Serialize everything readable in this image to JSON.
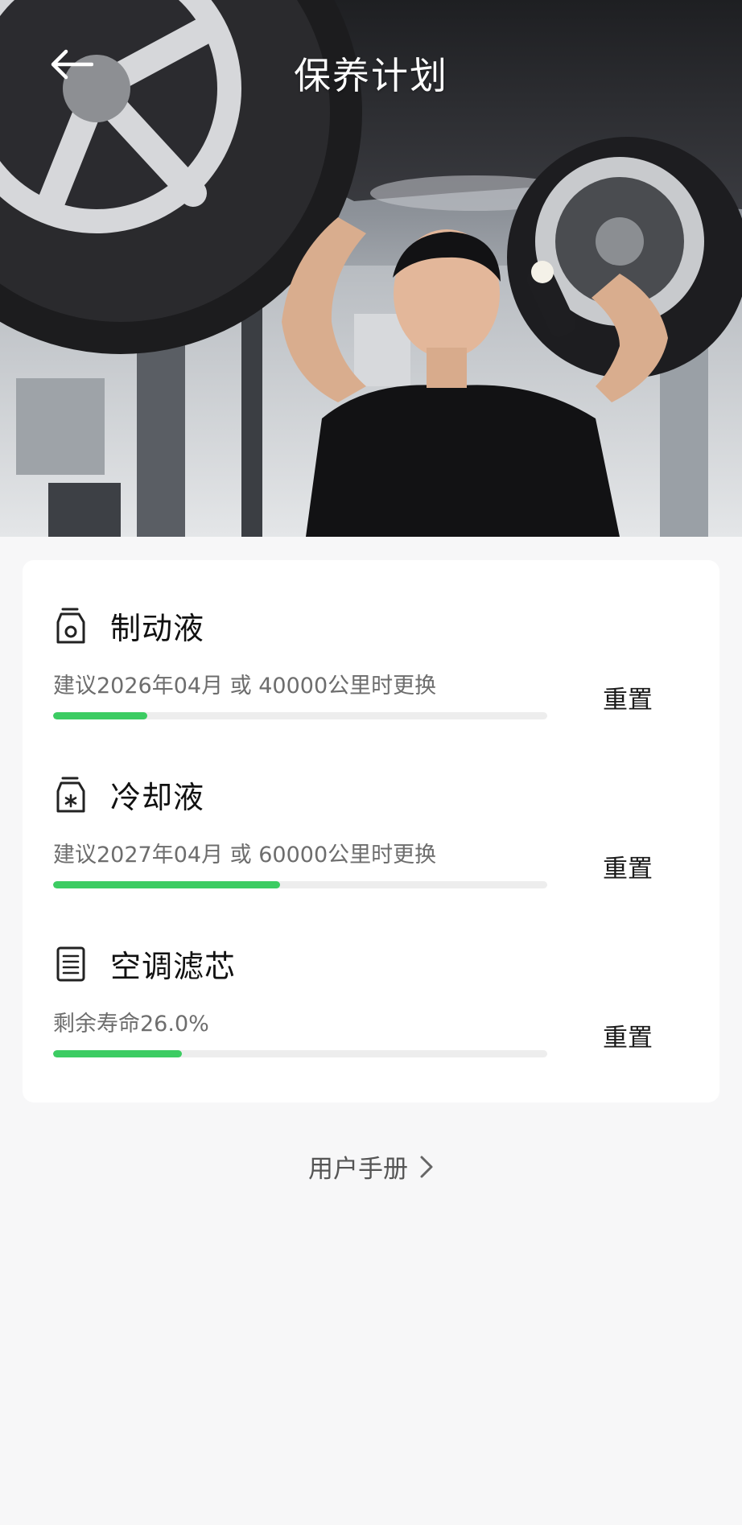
{
  "header": {
    "title": "保养计划",
    "back_icon": "arrow-left-icon"
  },
  "hero": {
    "description_icon": "photo"
  },
  "maintenance": {
    "items": [
      {
        "icon": "brake-fluid-bottle-icon",
        "title": "制动液",
        "desc": "建议2026年04月 或 40000公里时更换",
        "progress": 0.19,
        "reset_label": "重置"
      },
      {
        "icon": "coolant-bottle-icon",
        "title": "冷却液",
        "desc": "建议2027年04月 或 60000公里时更换",
        "progress": 0.46,
        "reset_label": "重置"
      },
      {
        "icon": "filter-document-icon",
        "title": "空调滤芯",
        "desc": "剩余寿命26.0%",
        "progress": 0.26,
        "reset_label": "重置"
      }
    ]
  },
  "footer": {
    "manual_label": "用户手册"
  },
  "colors": {
    "progress_fill": "#3ccc62",
    "progress_track": "#ededed",
    "page_bg": "#f7f7f8"
  }
}
